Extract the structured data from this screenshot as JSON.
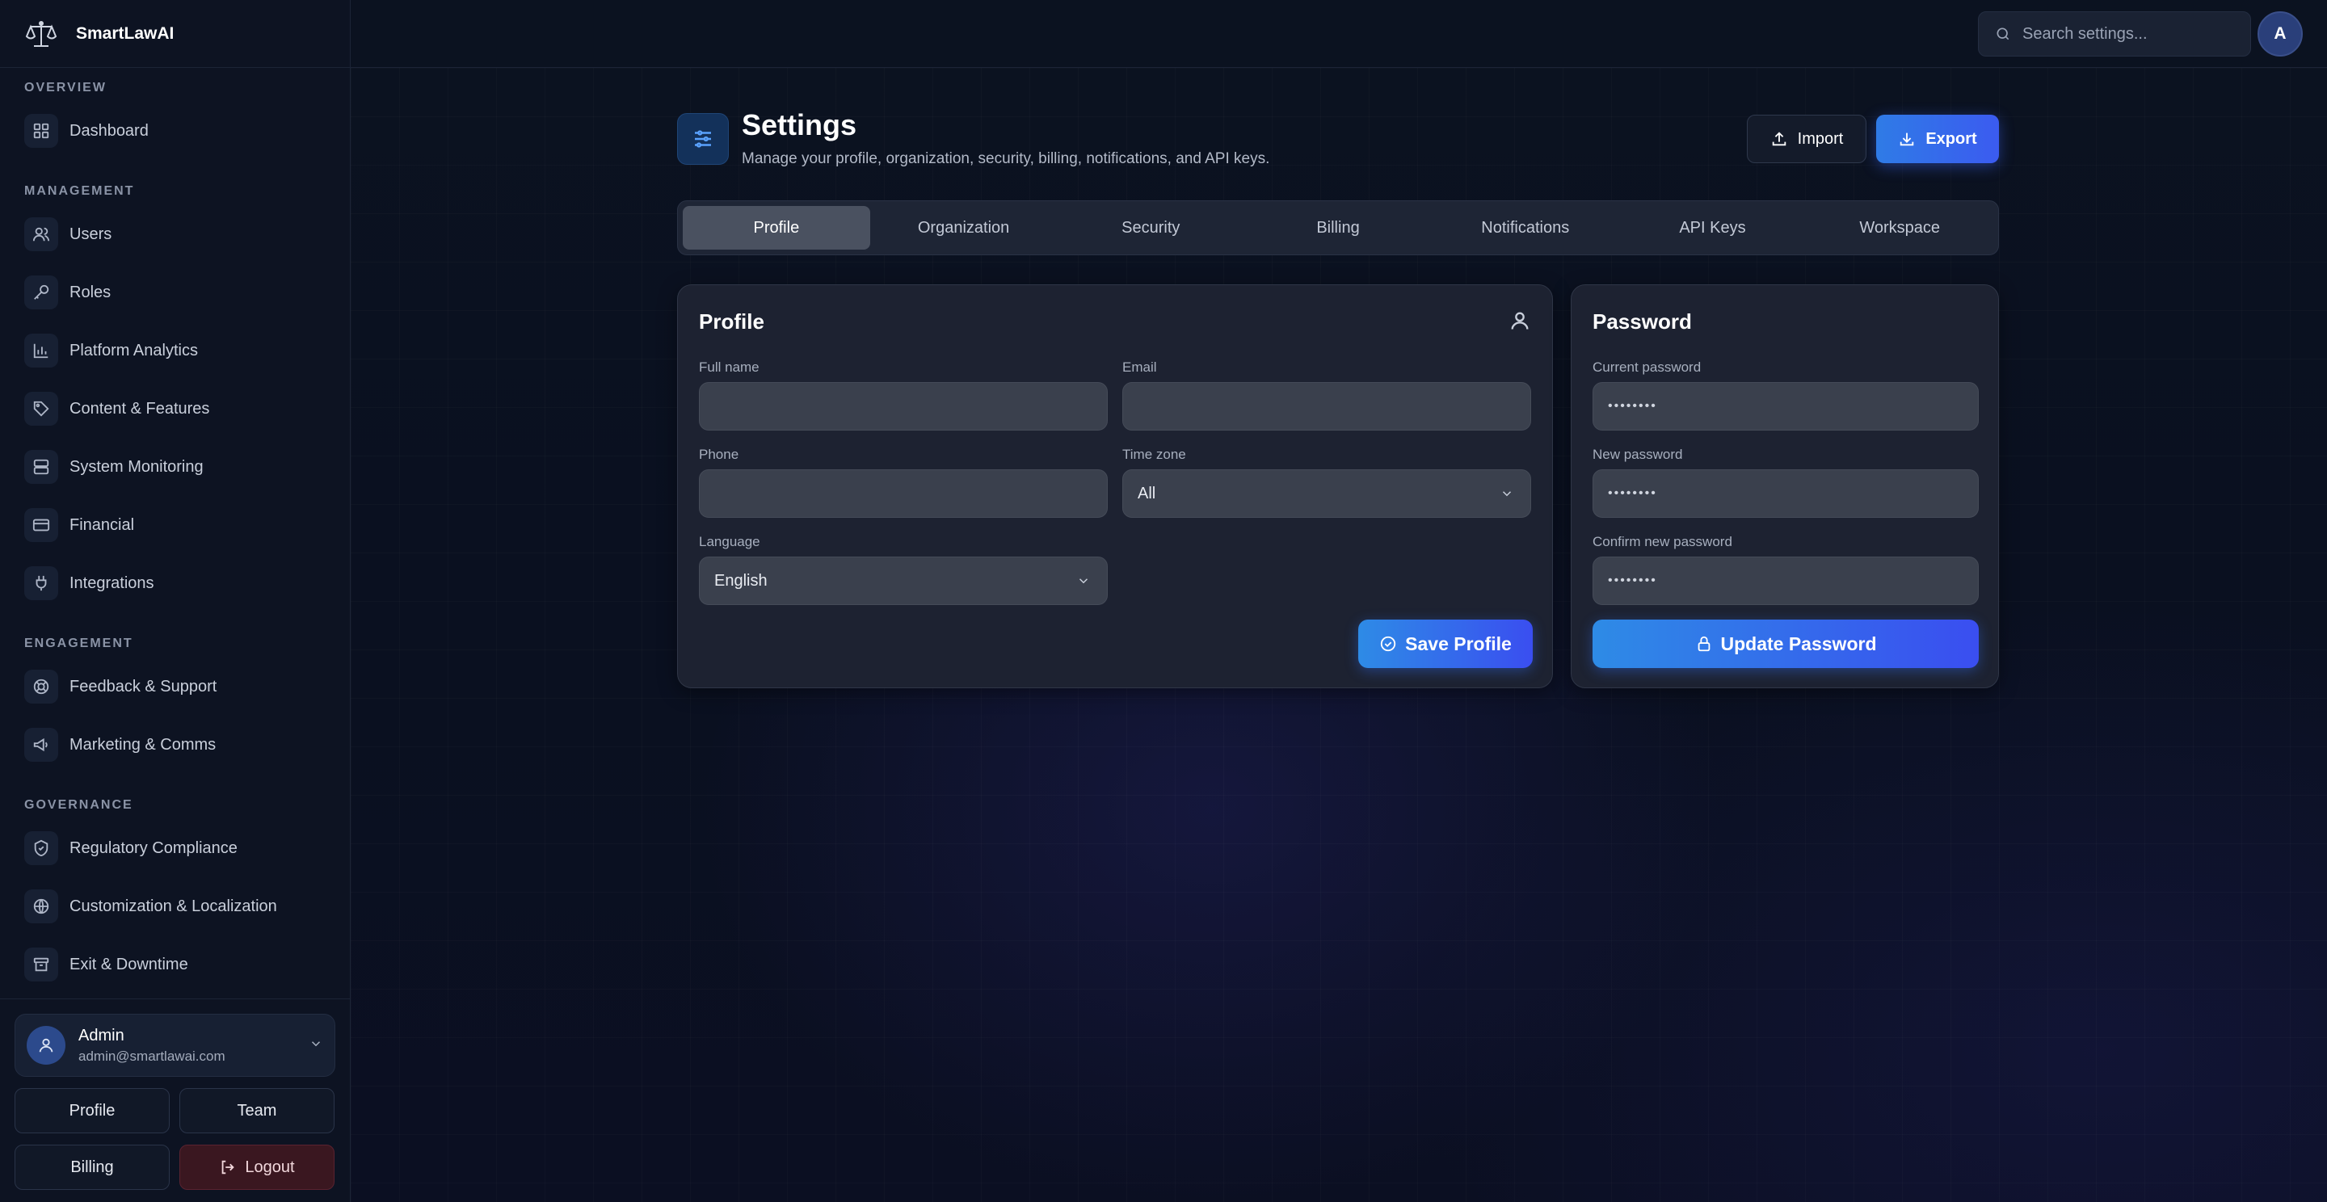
{
  "brand": {
    "name": "SmartLawAI"
  },
  "topbar": {
    "search_placeholder": "Search settings...",
    "avatar_initial": "A"
  },
  "sidebar": {
    "sections": [
      {
        "title": "OVERVIEW",
        "items": [
          {
            "label": "Dashboard",
            "icon": "dashboard-icon"
          }
        ]
      },
      {
        "title": "MANAGEMENT",
        "items": [
          {
            "label": "Users",
            "icon": "users-icon"
          },
          {
            "label": "Roles",
            "icon": "key-icon"
          },
          {
            "label": "Platform Analytics",
            "icon": "bar-chart-icon"
          },
          {
            "label": "Content & Features",
            "icon": "tag-icon"
          },
          {
            "label": "System Monitoring",
            "icon": "server-icon"
          },
          {
            "label": "Financial",
            "icon": "credit-card-icon"
          },
          {
            "label": "Integrations",
            "icon": "plug-icon"
          }
        ]
      },
      {
        "title": "ENGAGEMENT",
        "items": [
          {
            "label": "Feedback & Support",
            "icon": "lifebuoy-icon"
          },
          {
            "label": "Marketing & Comms",
            "icon": "megaphone-icon"
          }
        ]
      },
      {
        "title": "GOVERNANCE",
        "items": [
          {
            "label": "Regulatory Compliance",
            "icon": "shield-icon"
          },
          {
            "label": "Customization & Localization",
            "icon": "globe-icon"
          },
          {
            "label": "Exit & Downtime",
            "icon": "archive-icon"
          }
        ]
      }
    ],
    "user": {
      "name": "Admin",
      "email": "admin@smartlawai.com"
    },
    "buttons": {
      "profile": "Profile",
      "team": "Team",
      "billing": "Billing",
      "logout": "Logout"
    }
  },
  "header": {
    "title": "Settings",
    "subtitle": "Manage your profile, organization, security, billing, notifications, and API keys.",
    "import_label": "Import",
    "export_label": "Export"
  },
  "tabs": [
    "Profile",
    "Organization",
    "Security",
    "Billing",
    "Notifications",
    "API Keys",
    "Workspace"
  ],
  "active_tab": "Profile",
  "profile_card": {
    "title": "Profile",
    "full_name_label": "Full name",
    "full_name_value": "",
    "email_label": "Email",
    "email_value": "",
    "phone_label": "Phone",
    "phone_value": "",
    "timezone_label": "Time zone",
    "timezone_value": "All",
    "language_label": "Language",
    "language_value": "English",
    "save_label": "Save Profile"
  },
  "password_card": {
    "title": "Password",
    "current_label": "Current password",
    "current_value": "••••••••",
    "new_label": "New password",
    "new_value": "••••••••",
    "confirm_label": "Confirm new password",
    "confirm_value": "••••••••",
    "update_label": "Update Password"
  },
  "colors": {
    "accent_start": "#2e8be6",
    "accent_end": "#3a4ef0",
    "logout_bg": "#3a1720"
  }
}
